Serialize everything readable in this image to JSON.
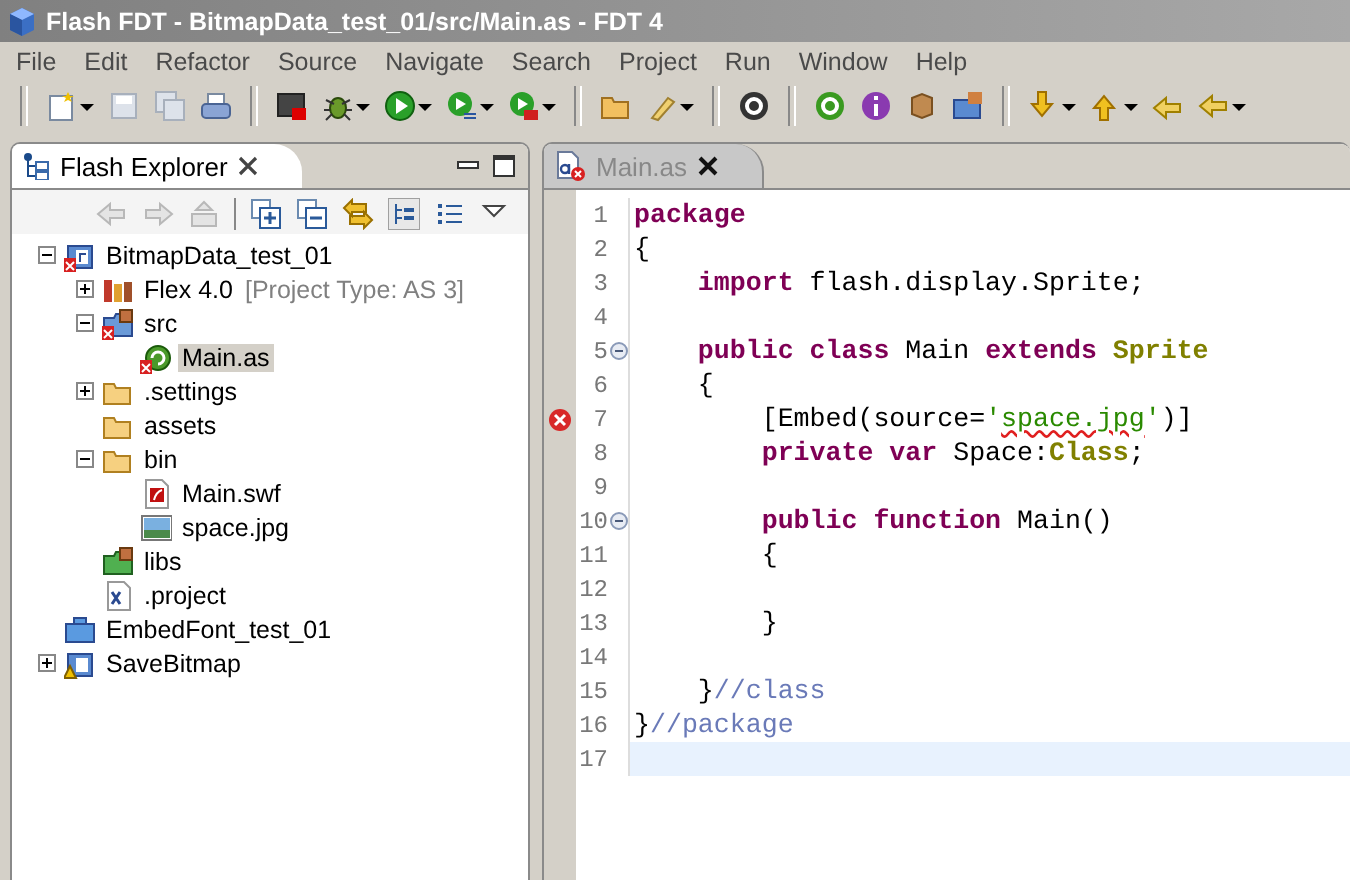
{
  "window": {
    "title": "Flash FDT - BitmapData_test_01/src/Main.as - FDT 4"
  },
  "menu": [
    "File",
    "Edit",
    "Refactor",
    "Source",
    "Navigate",
    "Search",
    "Project",
    "Run",
    "Window",
    "Help"
  ],
  "explorer": {
    "title": "Flash Explorer",
    "tree": [
      {
        "label": "BitmapData_test_01",
        "kind": "project-error",
        "expanded": true,
        "selected": false,
        "children": [
          {
            "label": "Flex 4.0",
            "note": "[Project Type: AS 3]",
            "kind": "library",
            "expanded": false,
            "selected": false
          },
          {
            "label": "src",
            "kind": "source-folder",
            "expanded": true,
            "selected": false,
            "children": [
              {
                "label": "Main.as",
                "kind": "script-file",
                "selected": true
              }
            ]
          },
          {
            "label": ".settings",
            "kind": "folder",
            "expanded": false,
            "selected": false
          },
          {
            "label": "assets",
            "kind": "folder",
            "selected": false
          },
          {
            "label": "bin",
            "kind": "folder",
            "expanded": true,
            "selected": false,
            "children": [
              {
                "label": "Main.swf",
                "kind": "swf-file",
                "selected": false
              },
              {
                "label": "space.jpg",
                "kind": "image-file",
                "selected": false
              }
            ]
          },
          {
            "label": "libs",
            "kind": "library-folder",
            "selected": false
          },
          {
            "label": ".project",
            "kind": "xml-file",
            "selected": false
          }
        ]
      },
      {
        "label": "EmbedFont_test_01",
        "kind": "closed-project",
        "selected": false
      },
      {
        "label": "SaveBitmap",
        "kind": "project-warning",
        "expanded": false,
        "selected": false
      }
    ]
  },
  "editor": {
    "tab": {
      "label": "Main.as",
      "selected": false
    },
    "lines": [
      {
        "number": "1",
        "tokens": [
          {
            "kind": "keyword",
            "text": "package"
          }
        ]
      },
      {
        "number": "2",
        "tokens": [
          {
            "kind": "plain",
            "text": "{"
          }
        ]
      },
      {
        "number": "3",
        "tokens": [
          {
            "kind": "keyword",
            "text": "    import"
          },
          {
            "kind": "plain",
            "text": " flash.display.Sprite;"
          }
        ]
      },
      {
        "number": "4"
      },
      {
        "number": "5",
        "fold": true,
        "tokens": [
          {
            "kind": "keyword",
            "text": "    public class"
          },
          {
            "kind": "plain",
            "text": " Main "
          },
          {
            "kind": "keyword",
            "text": "extends"
          },
          {
            "kind": "type",
            "text": " Sprite"
          }
        ]
      },
      {
        "number": "6",
        "tokens": [
          {
            "kind": "plain",
            "text": "    {"
          }
        ]
      },
      {
        "number": "7",
        "error": true,
        "tokens": [
          {
            "kind": "plain",
            "text": "        [Embed(source="
          },
          {
            "kind": "string",
            "text": "'"
          },
          {
            "kind": "string",
            "text": "space.jpg",
            "squiggle": true
          },
          {
            "kind": "string",
            "text": "'"
          },
          {
            "kind": "plain",
            "text": ")]"
          }
        ]
      },
      {
        "number": "8",
        "tokens": [
          {
            "kind": "keyword",
            "text": "        private var"
          },
          {
            "kind": "plain",
            "text": " Space:"
          },
          {
            "kind": "type",
            "text": "Class"
          },
          {
            "kind": "plain",
            "text": ";"
          }
        ]
      },
      {
        "number": "9"
      },
      {
        "number": "10",
        "fold": true,
        "tokens": [
          {
            "kind": "keyword",
            "text": "        public function"
          },
          {
            "kind": "plain",
            "text": " Main()"
          }
        ]
      },
      {
        "number": "11",
        "tokens": [
          {
            "kind": "plain",
            "text": "        {"
          }
        ]
      },
      {
        "number": "12"
      },
      {
        "number": "13",
        "tokens": [
          {
            "kind": "plain",
            "text": "        }"
          }
        ]
      },
      {
        "number": "14"
      },
      {
        "number": "15",
        "tokens": [
          {
            "kind": "plain",
            "text": "    }"
          },
          {
            "kind": "comment",
            "text": "//class"
          }
        ]
      },
      {
        "number": "16",
        "tokens": [
          {
            "kind": "plain",
            "text": "}"
          },
          {
            "kind": "comment",
            "text": "//package"
          }
        ]
      },
      {
        "number": "17",
        "current": true
      }
    ]
  }
}
